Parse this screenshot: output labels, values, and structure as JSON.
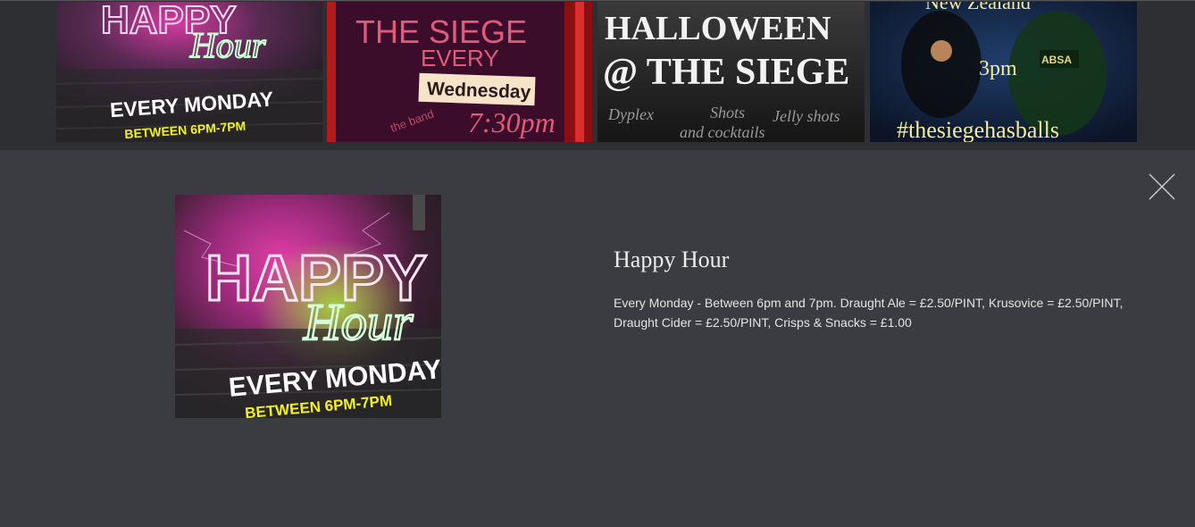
{
  "gallery": {
    "tiles": [
      {
        "name": "happy-hour",
        "lines": [
          "HAPPY",
          "Hour",
          "EVERY MONDAY",
          "BETWEEN 6PM-7PM"
        ]
      },
      {
        "name": "the-siege-wednesday",
        "lines": [
          "THE SIEGE",
          "EVERY",
          "Wednesday",
          "7:30pm",
          "the band"
        ]
      },
      {
        "name": "halloween",
        "lines": [
          "HALLOWEEN",
          "@ THE SIEGE",
          "Dyplex",
          "Shots",
          "Jelly shots",
          "and cocktails"
        ]
      },
      {
        "name": "rugby",
        "lines": [
          "New Zealand",
          "3pm",
          "#thesiegehasballs",
          "ABSA"
        ]
      }
    ]
  },
  "detail": {
    "title": "Happy Hour",
    "description": "Every Monday - Between 6pm and 7pm. Draught Ale = £2.50/PINT, Krusovice = £2.50/PINT, Draught Cider = £2.50/PINT, Crisps & Snacks = £1.00",
    "image_lines": [
      "HAPPY",
      "Hour",
      "EVERY MONDAY",
      "BETWEEN 6PM-7PM"
    ]
  },
  "controls": {
    "close_icon": "close-icon"
  },
  "colors": {
    "page_bg": "#3b3c41",
    "strip_bg": "#2e2f33",
    "title_text": "#ececec",
    "body_text": "#e4e4e4",
    "neon_pink": "#f06bd0",
    "neon_green": "#9aff9a",
    "neon_yellow": "#f2f21a"
  }
}
